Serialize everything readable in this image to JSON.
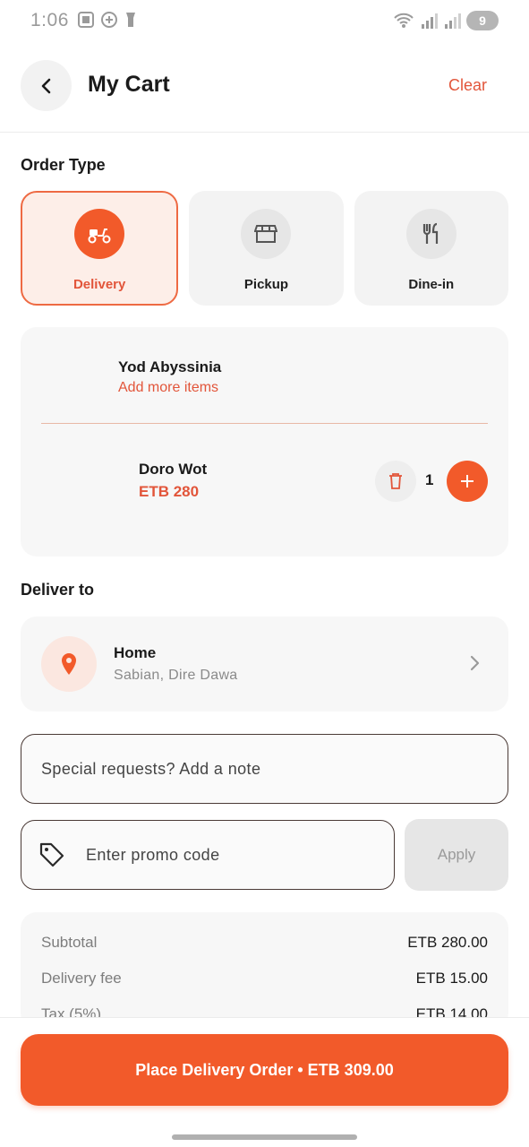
{
  "status_bar": {
    "time": "1:06",
    "battery": "9"
  },
  "header": {
    "title": "My Cart",
    "clear_label": "Clear"
  },
  "order_type": {
    "title": "Order Type",
    "options": [
      {
        "label": "Delivery",
        "icon": "scooter-icon",
        "selected": true
      },
      {
        "label": "Pickup",
        "icon": "store-icon",
        "selected": false
      },
      {
        "label": "Dine-in",
        "icon": "utensils-icon",
        "selected": false
      }
    ]
  },
  "cart": {
    "restaurant": "Yod Abyssinia",
    "add_more_label": "Add more items",
    "items": [
      {
        "name": "Doro Wot",
        "price": "ETB 280",
        "quantity": "1"
      }
    ]
  },
  "deliver_to": {
    "title": "Deliver to",
    "label": "Home",
    "address": "Sabian, Dire Dawa"
  },
  "note": {
    "placeholder": "Special requests? Add a note"
  },
  "promo": {
    "placeholder": "Enter promo code",
    "apply_label": "Apply"
  },
  "summary": {
    "rows": [
      {
        "label": "Subtotal",
        "value": "ETB 280.00"
      },
      {
        "label": "Delivery fee",
        "value": "ETB 15.00"
      },
      {
        "label": "Tax (5%)",
        "value": "ETB 14.00"
      }
    ]
  },
  "place_order": {
    "label": "Place Delivery Order • ETB 309.00"
  },
  "colors": {
    "accent": "#f25a2a",
    "accent_text": "#e2553a",
    "selected_bg": "#fdeee8"
  }
}
